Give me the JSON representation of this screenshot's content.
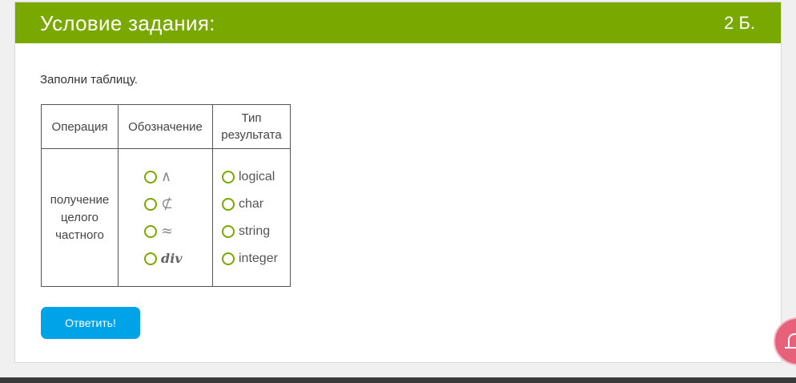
{
  "header": {
    "title": "Условие задания:",
    "points": "2 Б."
  },
  "prompt": "Заполни таблицу.",
  "table": {
    "headers": [
      "Операция",
      "Обозначение",
      "Тип результата"
    ],
    "header_type_line1": "Тип",
    "header_type_line2": "результата",
    "operation_line1": "получение",
    "operation_line2": "целого",
    "operation_line3": "частного",
    "symbol_options": [
      "∧",
      "⊄",
      "≈",
      "div"
    ],
    "type_options": [
      "logical",
      "char",
      "string",
      "integer"
    ]
  },
  "answer_button": "Ответить!",
  "colors": {
    "header_bg": "#79a900",
    "button_bg": "#00a3e8",
    "radio_border": "#79a900",
    "fab_bg": "#e8617a"
  },
  "icons": {
    "floating_button": "bell-icon"
  }
}
